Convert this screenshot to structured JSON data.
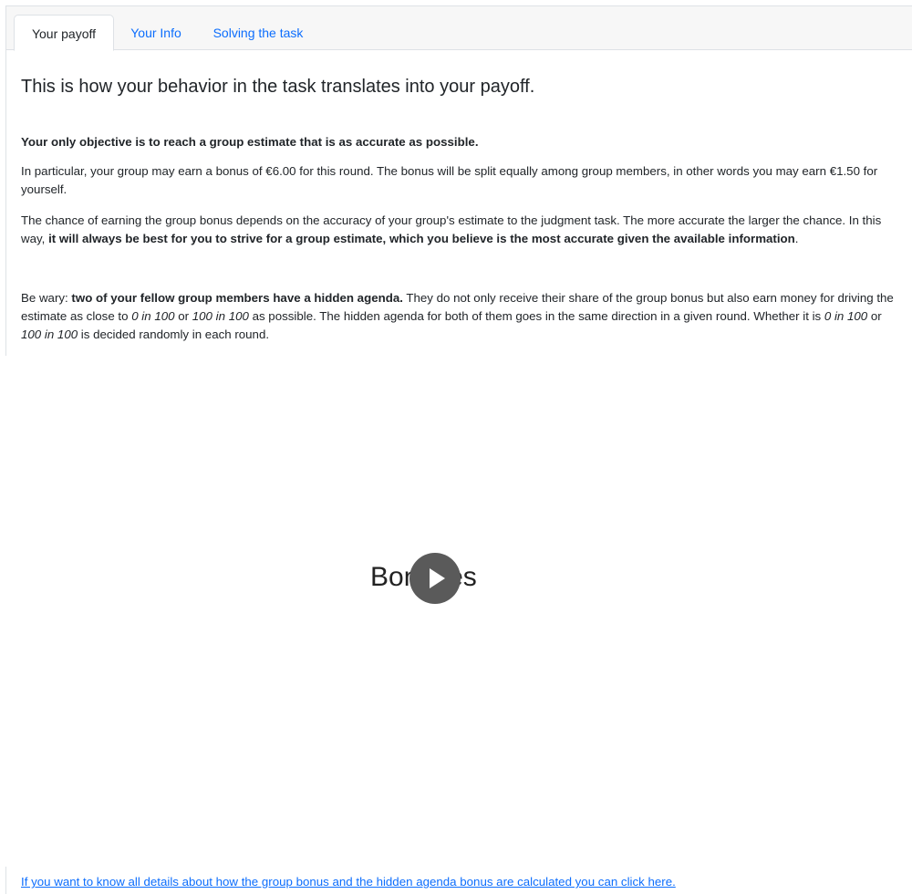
{
  "tabs": [
    {
      "label": "Your payoff",
      "active": true
    },
    {
      "label": "Your Info",
      "active": false
    },
    {
      "label": "Solving the task",
      "active": false
    }
  ],
  "heading": "This is how your behavior in the task translates into your payoff.",
  "objective": "Your only objective is to reach a group estimate that is as accurate as possible.",
  "paragraph1": "In particular, your group may earn a bonus of €6.00 for this round. The bonus will be split equally among group members, in other words you may earn €1.50 for yourself.",
  "paragraph2": {
    "part1": "The chance of earning the group bonus depends on the accuracy of your group's estimate to the judgment task. The more accurate the larger the chance. In this way, ",
    "bold": "it will always be best for you to strive for a group estimate, which you believe is the most accurate given the available information",
    "part2": "."
  },
  "paragraph3": {
    "part1": "Be wary: ",
    "bold": "two of your fellow group members have a hidden agenda.",
    "part2": " They do not only receive their share of the group bonus but also earn money for driving the estimate as close to ",
    "italic1": "0 in 100",
    "part3": " or ",
    "italic2": "100 in 100",
    "part4": " as possible. The hidden agenda for both of them goes in the same direction in a given round. Whether it is ",
    "italic3": "0 in 100",
    "part5": " or ",
    "italic4": "100 in 100",
    "part6": " is decided randomly in each round."
  },
  "video": {
    "title": "Bonuses",
    "play_icon": "play-icon"
  },
  "details_link": "If you want to know all details about how the group bonus and the hidden agenda bonus are calculated you can click here.",
  "colors": {
    "link": "#0d6efd",
    "text": "#212529",
    "tabbar_bg": "#f7f7f7",
    "play_bg": "#5a5a5a"
  }
}
